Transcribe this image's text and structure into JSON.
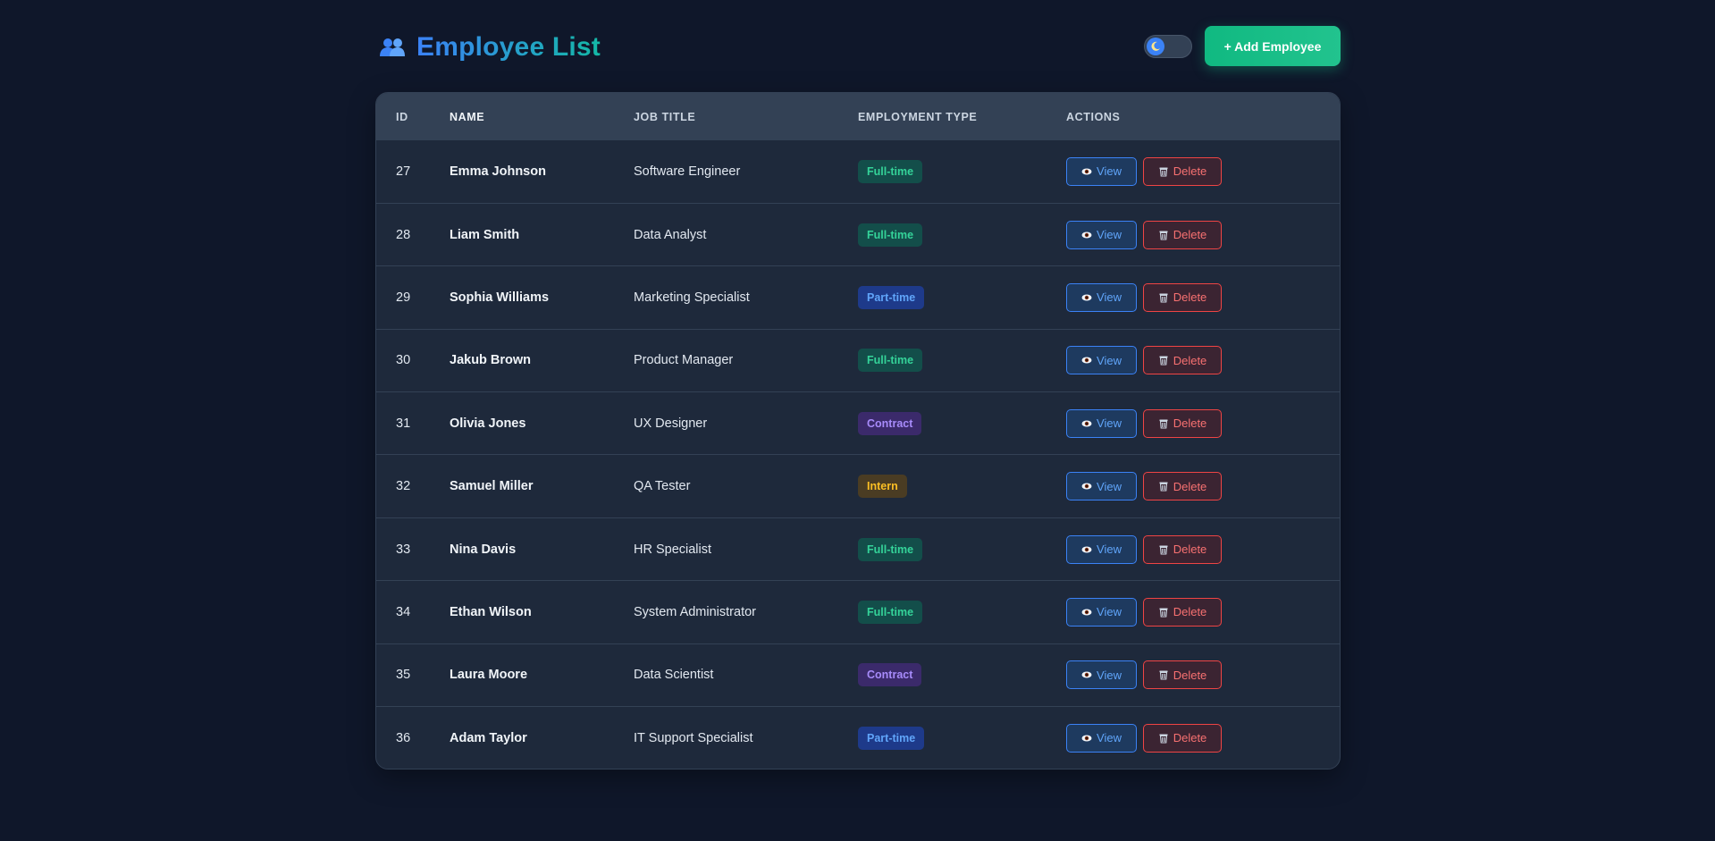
{
  "header": {
    "title": "Employee List",
    "title_icon": "users-icon",
    "theme_toggle_icon": "moon-icon",
    "add_button_label": "+ Add Employee"
  },
  "table": {
    "columns": [
      "ID",
      "NAME",
      "JOB TITLE",
      "EMPLOYMENT TYPE",
      "ACTIONS"
    ],
    "view_label": "View",
    "delete_label": "Delete",
    "rows": [
      {
        "id": "27",
        "name": "Emma Johnson",
        "job": "Software Engineer",
        "type": "Full-time"
      },
      {
        "id": "28",
        "name": "Liam Smith",
        "job": "Data Analyst",
        "type": "Full-time"
      },
      {
        "id": "29",
        "name": "Sophia Williams",
        "job": "Marketing Specialist",
        "type": "Part-time"
      },
      {
        "id": "30",
        "name": "Jakub Brown",
        "job": "Product Manager",
        "type": "Full-time"
      },
      {
        "id": "31",
        "name": "Olivia Jones",
        "job": "UX Designer",
        "type": "Contract"
      },
      {
        "id": "32",
        "name": "Samuel Miller",
        "job": "QA Tester",
        "type": "Intern"
      },
      {
        "id": "33",
        "name": "Nina Davis",
        "job": "HR Specialist",
        "type": "Full-time"
      },
      {
        "id": "34",
        "name": "Ethan Wilson",
        "job": "System Administrator",
        "type": "Full-time"
      },
      {
        "id": "35",
        "name": "Laura Moore",
        "job": "Data Scientist",
        "type": "Contract"
      },
      {
        "id": "36",
        "name": "Adam Taylor",
        "job": "IT Support Specialist",
        "type": "Part-time"
      }
    ]
  },
  "colors": {
    "background": "#0f172a",
    "card": "#1e293b",
    "header_row": "#334155",
    "accent_green": "#10b981",
    "accent_blue": "#3b82f6",
    "danger": "#ef4444"
  }
}
